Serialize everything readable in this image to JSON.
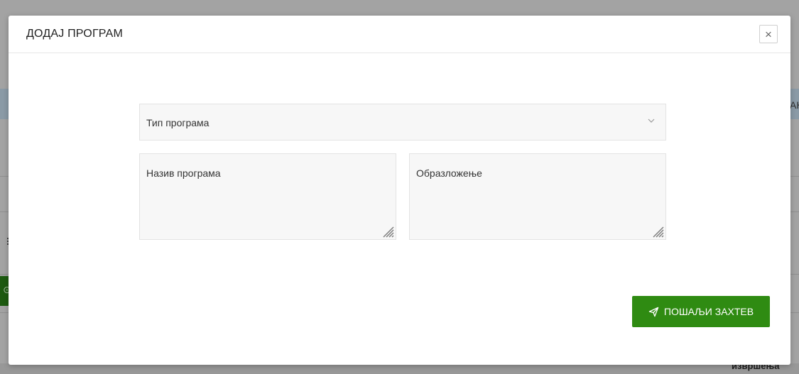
{
  "background": {
    "right_edge_text": "АН",
    "bottom_right_text": "извршења"
  },
  "modal": {
    "title": "ДОДАЈ ПРОГРАМ",
    "close_symbol": "×",
    "program_type_select": {
      "placeholder": "Тип програма",
      "icon": "chevron-down-icon"
    },
    "program_name_textarea": {
      "placeholder": "Назив програма"
    },
    "justification_textarea": {
      "placeholder": "Образложење"
    },
    "submit_button": {
      "label": "ПОШАЉИ ЗАХТЕВ",
      "icon": "paper-plane-icon"
    }
  },
  "colors": {
    "primary_green": "#2f8b12",
    "field_background": "#f7f7f7"
  }
}
